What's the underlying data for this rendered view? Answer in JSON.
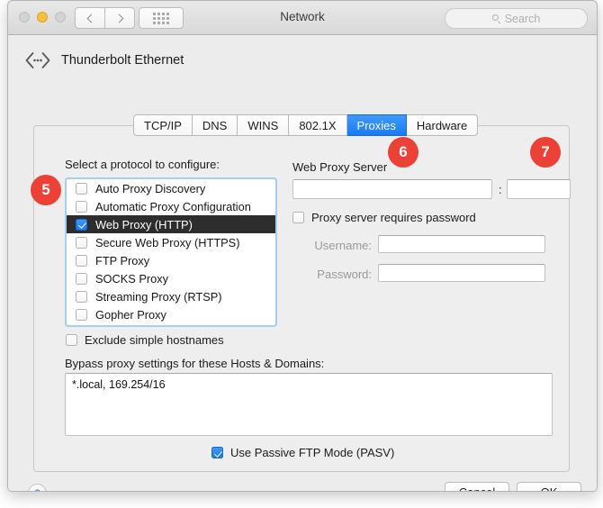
{
  "window": {
    "title": "Network",
    "traffic_lights": [
      "close-disabled",
      "minimize-amber",
      "zoom-disabled"
    ],
    "search_placeholder": "Search"
  },
  "device": {
    "name": "Thunderbolt Ethernet",
    "icon": "thunderbolt-icon"
  },
  "tabs": [
    {
      "label": "TCP/IP",
      "active": false
    },
    {
      "label": "DNS",
      "active": false
    },
    {
      "label": "WINS",
      "active": false
    },
    {
      "label": "802.1X",
      "active": false
    },
    {
      "label": "Proxies",
      "active": true
    },
    {
      "label": "Hardware",
      "active": false
    }
  ],
  "protocols": {
    "heading": "Select a protocol to configure:",
    "items": [
      {
        "label": "Auto Proxy Discovery",
        "checked": false,
        "selected": false
      },
      {
        "label": "Automatic Proxy Configuration",
        "checked": false,
        "selected": false
      },
      {
        "label": "Web Proxy (HTTP)",
        "checked": true,
        "selected": true
      },
      {
        "label": "Secure Web Proxy (HTTPS)",
        "checked": false,
        "selected": false
      },
      {
        "label": "FTP Proxy",
        "checked": false,
        "selected": false
      },
      {
        "label": "SOCKS Proxy",
        "checked": false,
        "selected": false
      },
      {
        "label": "Streaming Proxy (RTSP)",
        "checked": false,
        "selected": false
      },
      {
        "label": "Gopher Proxy",
        "checked": false,
        "selected": false
      }
    ],
    "exclude_simple_hostnames": {
      "label": "Exclude simple hostnames",
      "checked": false
    }
  },
  "proxy_server": {
    "heading": "Web Proxy Server",
    "host_value": "",
    "port_separator": ":",
    "port_value": "",
    "requires_password": {
      "label": "Proxy server requires password",
      "checked": false
    },
    "username_label": "Username:",
    "username_value": "",
    "password_label": "Password:",
    "password_value": ""
  },
  "bypass": {
    "heading": "Bypass proxy settings for these Hosts & Domains:",
    "value": "*.local, 169.254/16"
  },
  "passive_ftp": {
    "label": "Use Passive FTP Mode (PASV)",
    "checked": true
  },
  "footer": {
    "help_label": "?",
    "cancel_label": "Cancel",
    "ok_label": "OK"
  },
  "badges": [
    {
      "number": "5"
    },
    {
      "number": "6"
    },
    {
      "number": "7"
    }
  ],
  "colors": {
    "accent_blue": "#1b7bf0",
    "badge_red": "#ec4136",
    "focus_ring": "#a6cdf2",
    "selection_dark": "#2d2d2d"
  }
}
